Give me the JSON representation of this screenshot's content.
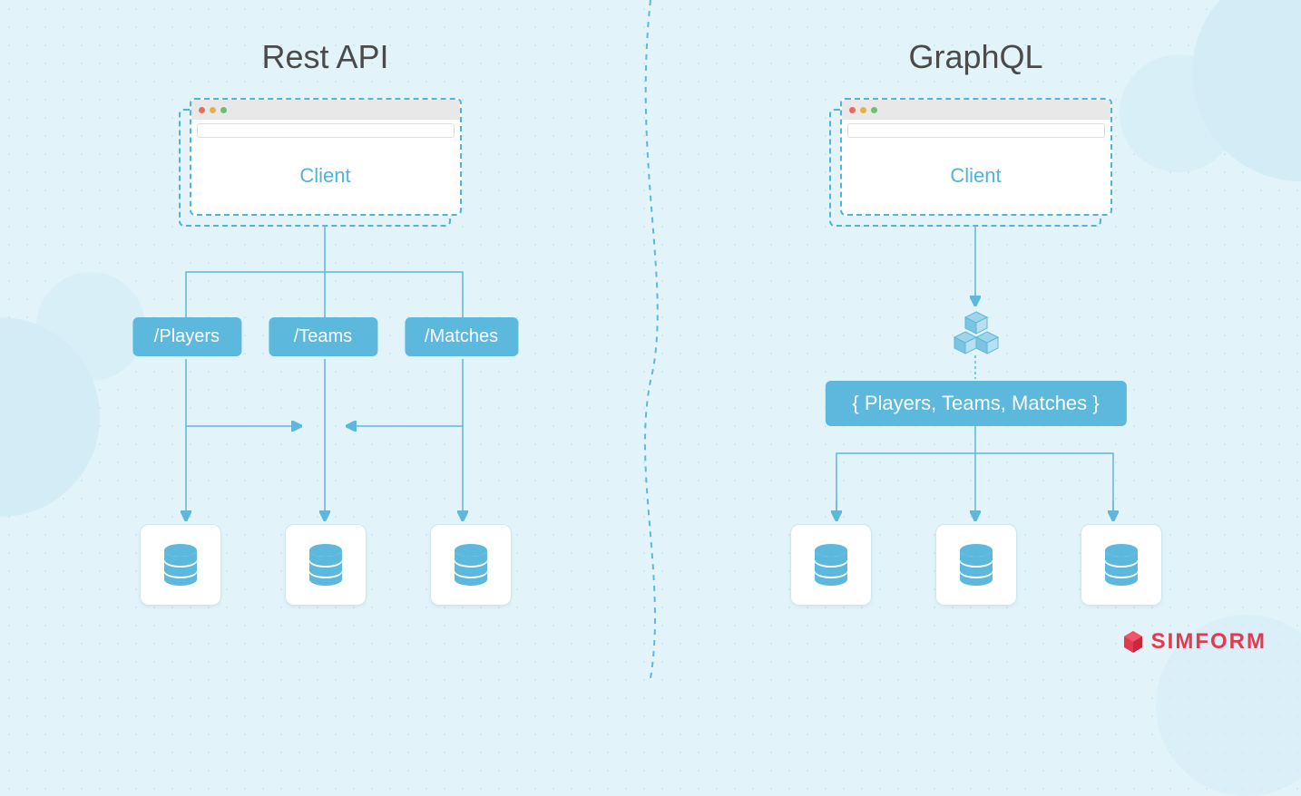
{
  "left": {
    "title": "Rest API",
    "client_label": "Client",
    "endpoints": [
      "/Players",
      "/Teams",
      "/Matches"
    ]
  },
  "right": {
    "title": "GraphQL",
    "client_label": "Client",
    "query": "{ Players, Teams, Matches }"
  },
  "brand": "SIMFORM"
}
